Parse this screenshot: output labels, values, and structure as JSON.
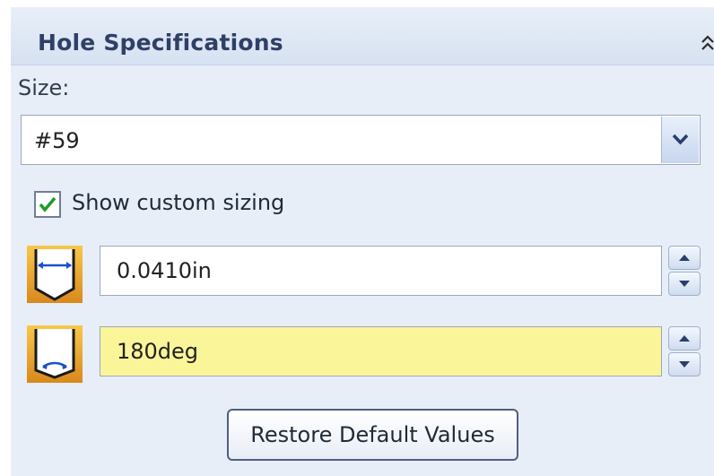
{
  "panel": {
    "title": "Hole Specifications",
    "collapse_icon": "double-chevron-up-icon"
  },
  "size": {
    "label": "Size:",
    "selected": "#59",
    "dropdown_icon": "chevron-down-icon"
  },
  "custom_sizing": {
    "checked": true,
    "label": "Show custom sizing"
  },
  "fields": [
    {
      "icon": "hole-diameter-icon",
      "value": "0.0410in",
      "highlighted": false
    },
    {
      "icon": "drill-angle-icon",
      "value": "180deg",
      "highlighted": true
    }
  ],
  "restore_button": {
    "label": "Restore Default Values"
  },
  "colors": {
    "panel_bg": "#e8eef8",
    "title": "#2f3f67",
    "highlight_field": "#fbf59a",
    "icon_gold": "#e8a826"
  }
}
